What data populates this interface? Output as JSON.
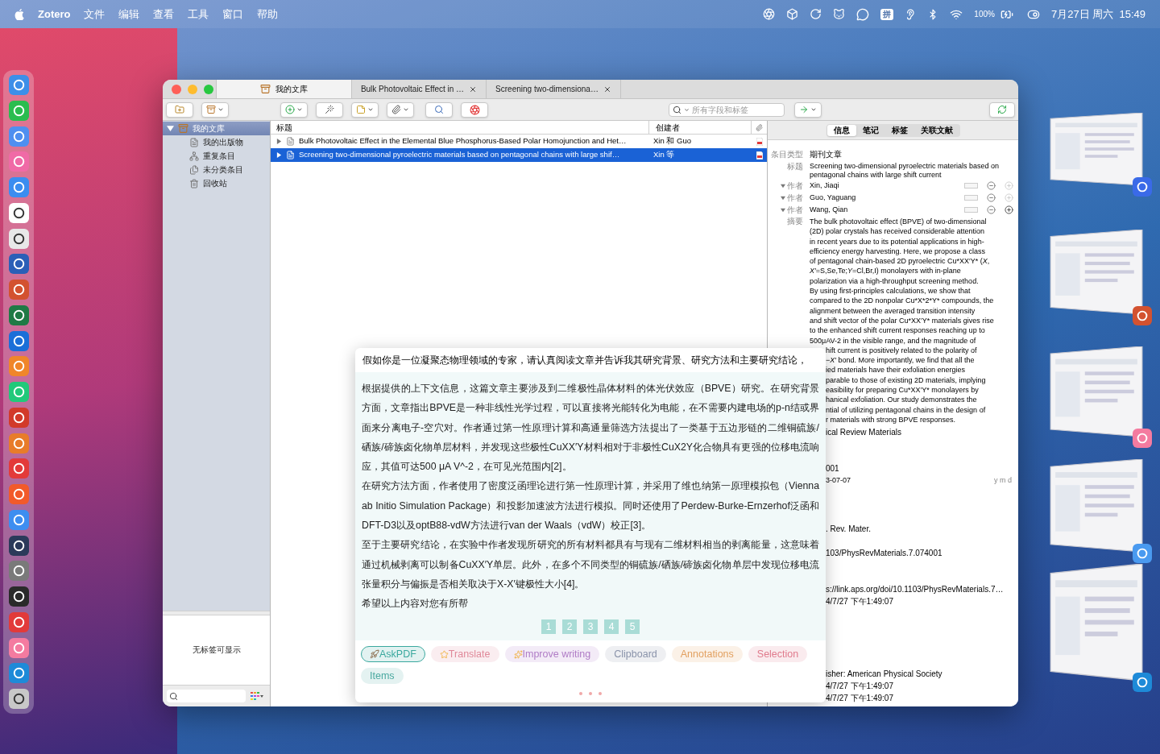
{
  "menu_bar": {
    "app": "Zotero",
    "menus": [
      "文件",
      "编辑",
      "查看",
      "工具",
      "窗口",
      "帮助"
    ],
    "input_method": "拼",
    "battery": "100%",
    "datetime": "7月27日 周六  15:49"
  },
  "window": {
    "tabs": [
      {
        "label": "我的文库",
        "kind": "library",
        "selected": true
      },
      {
        "label": "Bulk Photovoltaic Effect in …",
        "kind": "reader",
        "selected": false
      },
      {
        "label": "Screening two-dimensiona…",
        "kind": "reader",
        "selected": false
      }
    ],
    "search": {
      "placeholder": "所有字段和标签"
    }
  },
  "collections": [
    {
      "label": "我的文库",
      "kind": "library",
      "expanded": true,
      "selected": true,
      "children": [
        {
          "label": "我的出版物",
          "kind": "publications",
          "selected": false
        },
        {
          "label": "重复条目",
          "kind": "duplicates",
          "selected": false
        },
        {
          "label": "未分类条目",
          "kind": "unfiled",
          "selected": false
        },
        {
          "label": "回收站",
          "kind": "trash",
          "selected": false
        }
      ]
    }
  ],
  "tag_pane": {
    "empty_text": "无标签可显示"
  },
  "items_table": {
    "columns": [
      "标题",
      "创建者"
    ],
    "rows": [
      {
        "title": "Bulk Photovoltaic Effect in the Elemental Blue Phosphorus-Based Polar Homojunction and Het…",
        "creator": "Xin 和 Guo",
        "selected": false
      },
      {
        "title": "Screening two-dimensional pyroelectric materials based on pentagonal chains with large shif…",
        "creator": "Xin 等",
        "selected": true
      }
    ]
  },
  "item_pane": {
    "tabs": [
      {
        "label": "信息",
        "selected": true
      },
      {
        "label": "笔记",
        "selected": false
      },
      {
        "label": "标签",
        "selected": false
      },
      {
        "label": "关联文献",
        "selected": false
      }
    ],
    "fields": [
      {
        "kind": "text",
        "label": "条目类型",
        "value": "期刊文章"
      },
      {
        "kind": "text",
        "label": "标题",
        "value": "Screening two-dimensional pyroelectric materials based on pentagonal chains with large shift current"
      },
      {
        "kind": "creator",
        "label": "作者",
        "value": "Xin, Jiaqi",
        "can_add": false
      },
      {
        "kind": "creator",
        "label": "作者",
        "value": "Guo, Yaguang",
        "can_add": false
      },
      {
        "kind": "creator",
        "label": "作者",
        "value": "Wang, Qian",
        "can_add": true
      }
    ],
    "abstract": {
      "label": "摘要",
      "lines": [
        "The bulk photovoltaic effect (BPVE) of two-dimensional",
        "(2D) polar crystals has received considerable attention",
        "in recent years due to its potential applications in high-",
        "efficiency energy harvesting. Here, we propose a class",
        "of pentagonal chain-based 2D pyroelectric Cu*XX′Y* (*X*,",
        "*X′*=S,Se,Te;*Y*=Cl,Br,I) monolayers with in-plane",
        "polarization via a high-throughput screening method.",
        "By using first-principles calculations, we show that",
        "compared to the 2D nonpolar Cu*X*2*Y* compounds, the",
        "alignment between the averaged transition intensity",
        "and shift vector of the polar Cu*XX′Y* materials gives rise",
        "to the enhanced shift current responses reaching up to",
        "500μAV-2 in the visible range, and the magnitude of"
      ],
      "covered_lines": [
        "hift current is positively related to the polarity of",
        "−*X′* bond. More importantly, we find that all the",
        "ied materials have their exfoliation energies",
        "parable to those of existing 2D materials, implying",
        "easibility for preparing Cu*XX′Y* monolayers by",
        "hanical exfoliation. Our study demonstrates the",
        "ntial of utilizing pentagonal chains in the design of",
        "r materials with strong BPVE responses."
      ]
    },
    "covered_rows": [
      {
        "kind": "value",
        "value": "ical Review Materials"
      },
      {
        "kind": "empty"
      },
      {
        "kind": "empty"
      },
      {
        "kind": "value",
        "value": "001"
      },
      {
        "kind": "date",
        "value": "3-07-07",
        "hint": "y m d"
      },
      {
        "kind": "empty"
      },
      {
        "kind": "empty"
      },
      {
        "kind": "empty"
      },
      {
        "kind": "value",
        "value": ". Rev. Mater."
      },
      {
        "kind": "empty"
      },
      {
        "kind": "value",
        "value": "103/PhysRevMaterials.7.074001"
      },
      {
        "kind": "empty"
      },
      {
        "kind": "empty"
      },
      {
        "kind": "value",
        "value": "s://link.aps.org/doi/10.1103/PhysRevMaterials.7…"
      },
      {
        "kind": "value",
        "value": "4/7/27 下午1:49:07"
      },
      {
        "kind": "empty"
      },
      {
        "kind": "empty"
      },
      {
        "kind": "empty"
      },
      {
        "kind": "empty"
      },
      {
        "kind": "empty"
      },
      {
        "kind": "value",
        "value": "isher: American Physical Society"
      },
      {
        "kind": "value",
        "value": "4/7/27 下午1:49:07"
      },
      {
        "kind": "value",
        "value": "4/7/27 下午1:49:07"
      }
    ]
  },
  "assistant": {
    "prompt": "假如你是一位凝聚态物理领域的专家，请认真阅读文章并告诉我其研究背景、研究方法和主要研究结论，",
    "answer": [
      "根据提供的上下文信息，这篇文章主要涉及到二维极性晶体材料的体光伏效应（BPVE）研究。在研究背景方面，文章指出BPVE是一种非线性光学过程，可以直接将光能转化为电能，在不需要内建电场的p-n结或界面来分离电子-空穴对。作者通过第一性原理计算和高通量筛选方法提出了一类基于五边形链的二维铜硫族/硒族/碲族卤化物单层材料，并发现这些极性CuXX′Y材料相对于非极性CuX2Y化合物具有更强的位移电流响应，其值可达500 μA V^-2，在可见光范围内[2]。",
      "在研究方法方面，作者使用了密度泛函理论进行第一性原理计算，并采用了维也纳第一原理模拟包（Vienna ab Initio Simulation Package）和投影加速波方法进行模拟。同时还使用了Perdew-Burke-Ernzerhof泛函和DFT-D3以及optB88-vdW方法进行van der Waals（vdW）校正[3]。",
      "至于主要研究结论，在实验中作者发现所研究的所有材料都具有与现有二维材料相当的剥离能量，这意味着通过机械剥离可以制备CuXX′Y单层。此外，在多个不同类型的铜硫族/硒族/碲族卤化物单层中发现位移电流张量积分与偏振是否相关取决于X-X′键极性大小[4]。",
      "希望以上内容对您有所帮"
    ],
    "pages": [
      "1",
      "2",
      "3",
      "4",
      "5"
    ],
    "chips": [
      {
        "label": "AskPDF",
        "kind": "rocket",
        "selected": true,
        "color": "#3aa89e"
      },
      {
        "label": "Translate",
        "kind": "star",
        "selected": false,
        "color": "#e0899a"
      },
      {
        "label": "Improve writing",
        "kind": "sparkle",
        "selected": false,
        "color": "#b07cc6"
      },
      {
        "label": "Clipboard",
        "kind": "plain",
        "selected": false,
        "color": "#8a93aa"
      },
      {
        "label": "Annotations",
        "kind": "plain",
        "selected": false,
        "color": "#e2a060"
      },
      {
        "label": "Selection",
        "kind": "plain",
        "selected": false,
        "color": "#e07a8c"
      },
      {
        "label": "Items",
        "kind": "plain",
        "selected": false,
        "color": "#4aa9a0"
      }
    ]
  }
}
